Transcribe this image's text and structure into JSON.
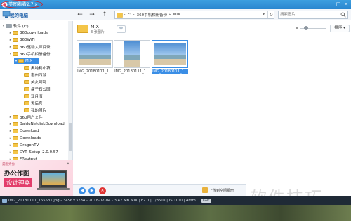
{
  "app": {
    "title": "美图看看",
    "version": "2.7.x",
    "window_controls": [
      "─",
      "□",
      "✕"
    ]
  },
  "sidebar": {
    "header": "我的电脑",
    "tree": [
      {
        "label": "软件 (F:)",
        "type": "drive",
        "expanded": true
      },
      {
        "label": "360downloads",
        "type": "folder"
      },
      {
        "label": "360WiFi",
        "type": "folder"
      },
      {
        "label": "360驱动大师目录",
        "type": "folder"
      },
      {
        "label": "360手机相册备份",
        "type": "folder",
        "expanded": true
      },
      {
        "label": "MIX",
        "type": "folder",
        "selected": true,
        "expanded": true
      },
      {
        "label": "奥地利小镇",
        "type": "folder"
      },
      {
        "label": "惠州西湖",
        "type": "folder"
      },
      {
        "label": "美女呵呵",
        "type": "folder"
      },
      {
        "label": "瘦子石公园",
        "type": "folder"
      },
      {
        "label": "双月湾",
        "type": "folder"
      },
      {
        "label": "天后宫",
        "type": "folder"
      },
      {
        "label": "我的照片",
        "type": "folder"
      },
      {
        "label": "360用户文件",
        "type": "folder"
      },
      {
        "label": "BaiduNetdiskDownload",
        "type": "folder"
      },
      {
        "label": "Download",
        "type": "folder"
      },
      {
        "label": "Downloads",
        "type": "folder"
      },
      {
        "label": "DragonTV",
        "type": "folder"
      },
      {
        "label": "DYT_Setup_2.0.0.57",
        "type": "folder"
      },
      {
        "label": "FRoutput",
        "type": "folder"
      }
    ]
  },
  "ad": {
    "small_label": "美图秀秀",
    "line1": "办公作图",
    "line2": "设计神器",
    "close": "✕"
  },
  "toolbar": {
    "back": "←",
    "forward": "→",
    "up": "↑",
    "breadcrumbs": [
      "F:",
      "360手机相册备份",
      "MIX"
    ],
    "dropdown": "▾",
    "refresh": "↻",
    "search_placeholder": "搜索图片"
  },
  "main": {
    "folder_name": "MIX",
    "folder_count": "3 张图片",
    "fav": "♥",
    "sort_label": "排序 ▾",
    "thumbnails": [
      {
        "label": "IMG_20180111_1...",
        "selected": false,
        "orientation": "landscape"
      },
      {
        "label": "IMG_20180111_1...",
        "selected": false,
        "orientation": "portrait"
      },
      {
        "label": "IMG_20180111_1...",
        "selected": true,
        "orientation": "landscape"
      }
    ]
  },
  "bottombar": {
    "buttons": [
      "◀",
      "▶",
      "✕"
    ],
    "upload_label": "上传到空间相册"
  },
  "status": {
    "text": "IMG_20180111_165531.jpg - 3456×3784 - 2018-02-04 - 3.47 MB  MIX | F2.0 | 1/850s | ISO100 | 4mm",
    "exif": "EXIF"
  },
  "watermark": "软件技巧",
  "colors": {
    "accent": "#3a8ee6",
    "titlebar": "#2a86cf",
    "folder": "#f4c548",
    "delete": "#e03434"
  }
}
